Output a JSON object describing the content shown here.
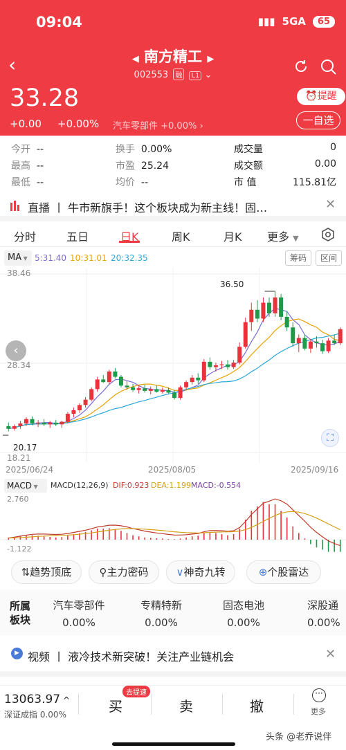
{
  "status_bar": {
    "time": "09:04",
    "network": "5GA",
    "battery": "65"
  },
  "header": {
    "name": "南方精工",
    "code": "002553",
    "tag1": "融",
    "tag2": "L1",
    "price": "33.28",
    "change": "+0.00",
    "change_pct": "+0.00%",
    "sector": "汽车零部件 +0.00%",
    "remind_label": "提醒",
    "fav_label": "一自选"
  },
  "stats": {
    "open_label": "今开",
    "open": "--",
    "high_label": "最高",
    "high": "--",
    "low_label": "最低",
    "low": "--",
    "turnover_label": "换手",
    "turnover": "0.00%",
    "pe_label": "市盈",
    "pe": "25.24",
    "avg_label": "均价",
    "avg": "--",
    "volume_label": "成交量",
    "volume": "0",
    "amount_label": "成交额",
    "amount": "0.00",
    "mktcap_label": "市 值",
    "mktcap": "115.81亿"
  },
  "live_banner": {
    "text": "直播 丨 牛市新旗手！这个板块成为新主线！固…"
  },
  "tabs": [
    "分时",
    "五日",
    "日K",
    "周K",
    "月K",
    "更多"
  ],
  "ma_legend": {
    "label": "MA",
    "ma5": "5:31.40",
    "ma10": "10:31.01",
    "ma20": "20:32.35",
    "chip_btn": "筹码",
    "range_btn": "区间"
  },
  "price_axis": {
    "top": "38.46",
    "mid": "28.34",
    "bottom": "18.21",
    "max_mark": "36.50",
    "min_mark": "20.17"
  },
  "dates": {
    "start": "2025/06/24",
    "mid": "2025/08/05",
    "end": "2025/09/16"
  },
  "macd_legend": {
    "label": "MACD",
    "params": "MACD(12,26,9)",
    "dif": "DIF:0.923",
    "dea": "DEA:1.199",
    "macd": "MACD:-0.554",
    "top": "2.760",
    "bottom": "-1.122"
  },
  "features": [
    "趋势顶底",
    "主力密码",
    "神奇九转",
    "个股雷达"
  ],
  "sectors": {
    "label1": "所属",
    "label2": "板块",
    "items": [
      {
        "name": "汽车零部件",
        "pct": "0.00%"
      },
      {
        "name": "专精特新",
        "pct": "0.00%"
      },
      {
        "name": "固态电池",
        "pct": "0.00%"
      },
      {
        "name": "深股通",
        "pct": "0.00%"
      }
    ]
  },
  "video_banner": {
    "text": "视频 丨 液冷技术新突破！关注产业链机会"
  },
  "bottom_bar": {
    "index_value": "13063.97",
    "index_name": "深证成指",
    "index_pct": "0.00%",
    "buy": "买",
    "buy_badge": "去提速",
    "sell": "卖",
    "cancel": "撤",
    "more": "更多",
    "watermark": "头条 @老乔说伴"
  },
  "chart_data": {
    "type": "candlestick",
    "date_range": [
      "2025/06/24",
      "2025/09/16"
    ],
    "ylim": [
      18.21,
      38.46
    ],
    "max": 36.5,
    "min": 20.17,
    "ohlc": [
      [
        21.2,
        21.6,
        20.6,
        20.9
      ],
      [
        20.9,
        21.4,
        20.7,
        21.2
      ],
      [
        21.2,
        21.8,
        20.9,
        21.5
      ],
      [
        21.5,
        22.2,
        21.2,
        22.0
      ],
      [
        22.0,
        22.3,
        21.3,
        21.5
      ],
      [
        21.5,
        21.9,
        21.1,
        21.6
      ],
      [
        21.6,
        22.0,
        21.2,
        21.4
      ],
      [
        21.4,
        21.8,
        21.0,
        21.6
      ],
      [
        21.6,
        21.9,
        21.2,
        21.4
      ],
      [
        21.4,
        21.8,
        21.0,
        21.7
      ],
      [
        21.7,
        22.8,
        21.5,
        22.6
      ],
      [
        22.6,
        23.3,
        22.2,
        23.0
      ],
      [
        23.0,
        23.8,
        22.7,
        23.6
      ],
      [
        23.6,
        24.5,
        23.3,
        24.2
      ],
      [
        24.2,
        25.6,
        24.0,
        25.4
      ],
      [
        25.4,
        26.8,
        25.1,
        26.5
      ],
      [
        26.5,
        27.0,
        26.1,
        26.2
      ],
      [
        26.2,
        27.6,
        25.9,
        27.4
      ],
      [
        27.4,
        27.8,
        26.6,
        26.8
      ],
      [
        26.8,
        27.0,
        25.6,
        25.8
      ],
      [
        25.8,
        26.3,
        25.3,
        25.6
      ],
      [
        25.6,
        26.0,
        25.1,
        25.3
      ],
      [
        25.3,
        25.8,
        24.9,
        25.5
      ],
      [
        25.5,
        25.9,
        25.0,
        25.2
      ],
      [
        25.2,
        25.7,
        24.8,
        25.4
      ],
      [
        25.4,
        25.8,
        25.0,
        25.1
      ],
      [
        25.1,
        25.6,
        24.9,
        25.3
      ],
      [
        25.3,
        25.6,
        24.9,
        25.0
      ],
      [
        25.0,
        25.3,
        24.2,
        24.4
      ],
      [
        24.4,
        25.8,
        24.2,
        25.6
      ],
      [
        25.6,
        26.4,
        25.3,
        26.2
      ],
      [
        26.2,
        27.0,
        25.9,
        26.7
      ],
      [
        26.7,
        27.2,
        26.0,
        26.4
      ],
      [
        26.4,
        28.8,
        26.2,
        28.5
      ],
      [
        28.5,
        29.0,
        27.6,
        27.9
      ],
      [
        27.9,
        28.4,
        27.4,
        28.1
      ],
      [
        28.1,
        28.6,
        27.7,
        28.2
      ],
      [
        28.2,
        28.7,
        27.6,
        27.9
      ],
      [
        27.9,
        28.7,
        27.7,
        28.4
      ],
      [
        28.4,
        30.7,
        28.2,
        30.2
      ],
      [
        30.2,
        33.5,
        30.0,
        33.0
      ],
      [
        33.0,
        35.2,
        32.0,
        34.4
      ],
      [
        34.4,
        35.5,
        33.0,
        33.4
      ],
      [
        33.4,
        35.8,
        33.0,
        35.2
      ],
      [
        35.2,
        35.8,
        33.6,
        34.0
      ],
      [
        34.0,
        36.5,
        33.6,
        35.8
      ],
      [
        35.8,
        36.2,
        33.2,
        33.6
      ],
      [
        33.6,
        34.2,
        32.0,
        32.4
      ],
      [
        32.4,
        33.0,
        30.2,
        30.6
      ],
      [
        30.6,
        31.6,
        29.6,
        31.2
      ],
      [
        31.2,
        31.6,
        29.8,
        30.0
      ],
      [
        30.0,
        31.1,
        29.5,
        30.8
      ],
      [
        30.8,
        31.4,
        30.1,
        30.6
      ],
      [
        30.6,
        31.0,
        29.4,
        29.7
      ],
      [
        29.7,
        31.2,
        29.5,
        30.9
      ],
      [
        30.9,
        31.6,
        30.4,
        30.6
      ],
      [
        30.6,
        32.4,
        30.4,
        32.2
      ]
    ],
    "macd_hist": [
      0.1,
      0.12,
      0.15,
      0.18,
      0.2,
      0.18,
      0.15,
      0.12,
      0.1,
      0.12,
      0.18,
      0.25,
      0.3,
      0.35,
      0.42,
      0.5,
      0.5,
      0.52,
      0.48,
      0.4,
      0.3,
      0.2,
      0.15,
      0.1,
      0.08,
      0.06,
      0.05,
      0.03,
      0.02,
      0.05,
      0.1,
      0.15,
      0.18,
      0.3,
      0.35,
      0.3,
      0.25,
      0.2,
      0.25,
      0.5,
      0.9,
      1.3,
      1.5,
      1.7,
      1.6,
      1.6,
      1.3,
      1.0,
      0.6,
      0.3,
      0.05,
      -0.2,
      -0.35,
      -0.45,
      -0.55,
      -0.55,
      -0.55
    ]
  }
}
